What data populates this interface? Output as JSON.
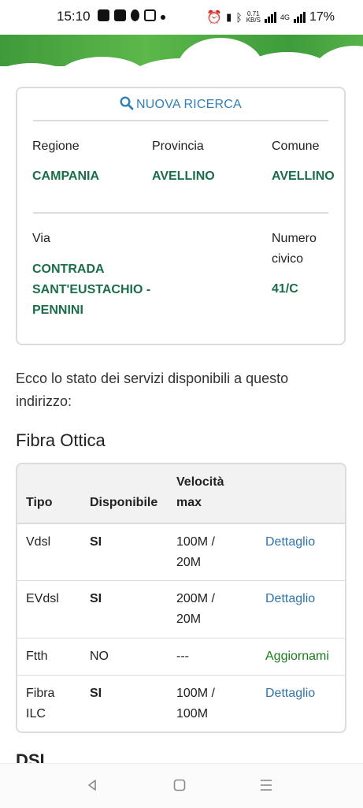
{
  "status_bar": {
    "time": "15:10",
    "speed_value": "0.71",
    "speed_unit": "KB/S",
    "network": "4G",
    "battery": "17%"
  },
  "search": {
    "label": "NUOVA RICERCA",
    "icon": "search-icon"
  },
  "address": {
    "region_label": "Regione",
    "region_value": "CAMPANIA",
    "province_label": "Provincia",
    "province_value": "AVELLINO",
    "municipality_label": "Comune",
    "municipality_value": "AVELLINO",
    "street_label": "Via",
    "street_value_lines": [
      "CONTRADA",
      "SANT'EUSTACHIO -",
      "PENNINI"
    ],
    "number_label_lines": [
      "Numero",
      "civico"
    ],
    "number_value": "41/C"
  },
  "intro_text": "Ecco lo stato dei servizi disponibili a questo indirizzo:",
  "section_title": "Fibra Ottica",
  "table": {
    "headers": {
      "type": "Tipo",
      "available": "Disponibile",
      "speed": [
        "Velocità",
        "max"
      ]
    },
    "rows": [
      {
        "type": [
          "Vdsl"
        ],
        "available": "SI",
        "speed": [
          "100M /",
          "20M"
        ],
        "action": "Dettaglio"
      },
      {
        "type": [
          "EVdsl"
        ],
        "available": "SI",
        "speed": [
          "200M /",
          "20M"
        ],
        "action": "Dettaglio"
      },
      {
        "type": [
          "Ftth"
        ],
        "available": "NO",
        "speed": [
          "---"
        ],
        "action": "Aggiornami"
      },
      {
        "type": [
          "Fibra",
          "ILC"
        ],
        "available": "SI",
        "speed": [
          "100M /",
          "100M"
        ],
        "action": "Dettaglio"
      }
    ]
  },
  "next_section_title": "DSL",
  "colors": {
    "accent_green": "#1a6e49",
    "link_blue": "#2f74a8",
    "update_green": "#1c7b1c"
  }
}
